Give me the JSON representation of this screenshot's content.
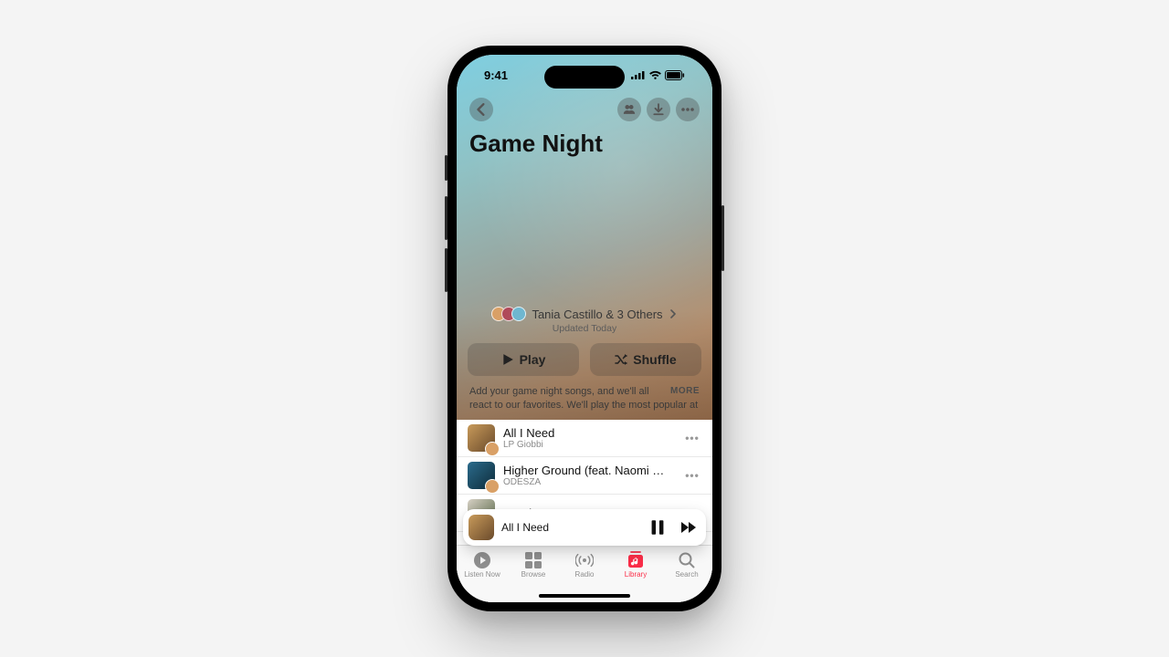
{
  "status": {
    "time": "9:41"
  },
  "playlist": {
    "title": "Game Night",
    "collaborators_text": "Tania Castillo & 3 Others",
    "updated": "Updated Today",
    "description": "Add your game night songs, and we'll all react to our favorites. We'll play the most popular at",
    "more_label": "MORE"
  },
  "buttons": {
    "play": "Play",
    "shuffle": "Shuffle"
  },
  "tracks": [
    {
      "title": "All I Need",
      "artist": "LP Giobbi"
    },
    {
      "title": "Higher Ground (feat. Naomi Wild)",
      "artist": "ODESZA"
    },
    {
      "title": "Lovely Sewer",
      "artist": ""
    }
  ],
  "now_playing": {
    "title": "All I Need"
  },
  "tabs": {
    "listen_now": "Listen Now",
    "browse": "Browse",
    "radio": "Radio",
    "library": "Library",
    "search": "Search"
  },
  "colors": {
    "accent": "#fa2d48",
    "avatar1": "#d9a066",
    "avatar2": "#b04a5a",
    "avatar3": "#6fb7d0",
    "art1a": "#c89a5a",
    "art1b": "#6a4a2b",
    "art2a": "#2b6b8c",
    "art2b": "#0e2c3a",
    "art3a": "#d6d0c4",
    "art3b": "#5b6a4a"
  }
}
